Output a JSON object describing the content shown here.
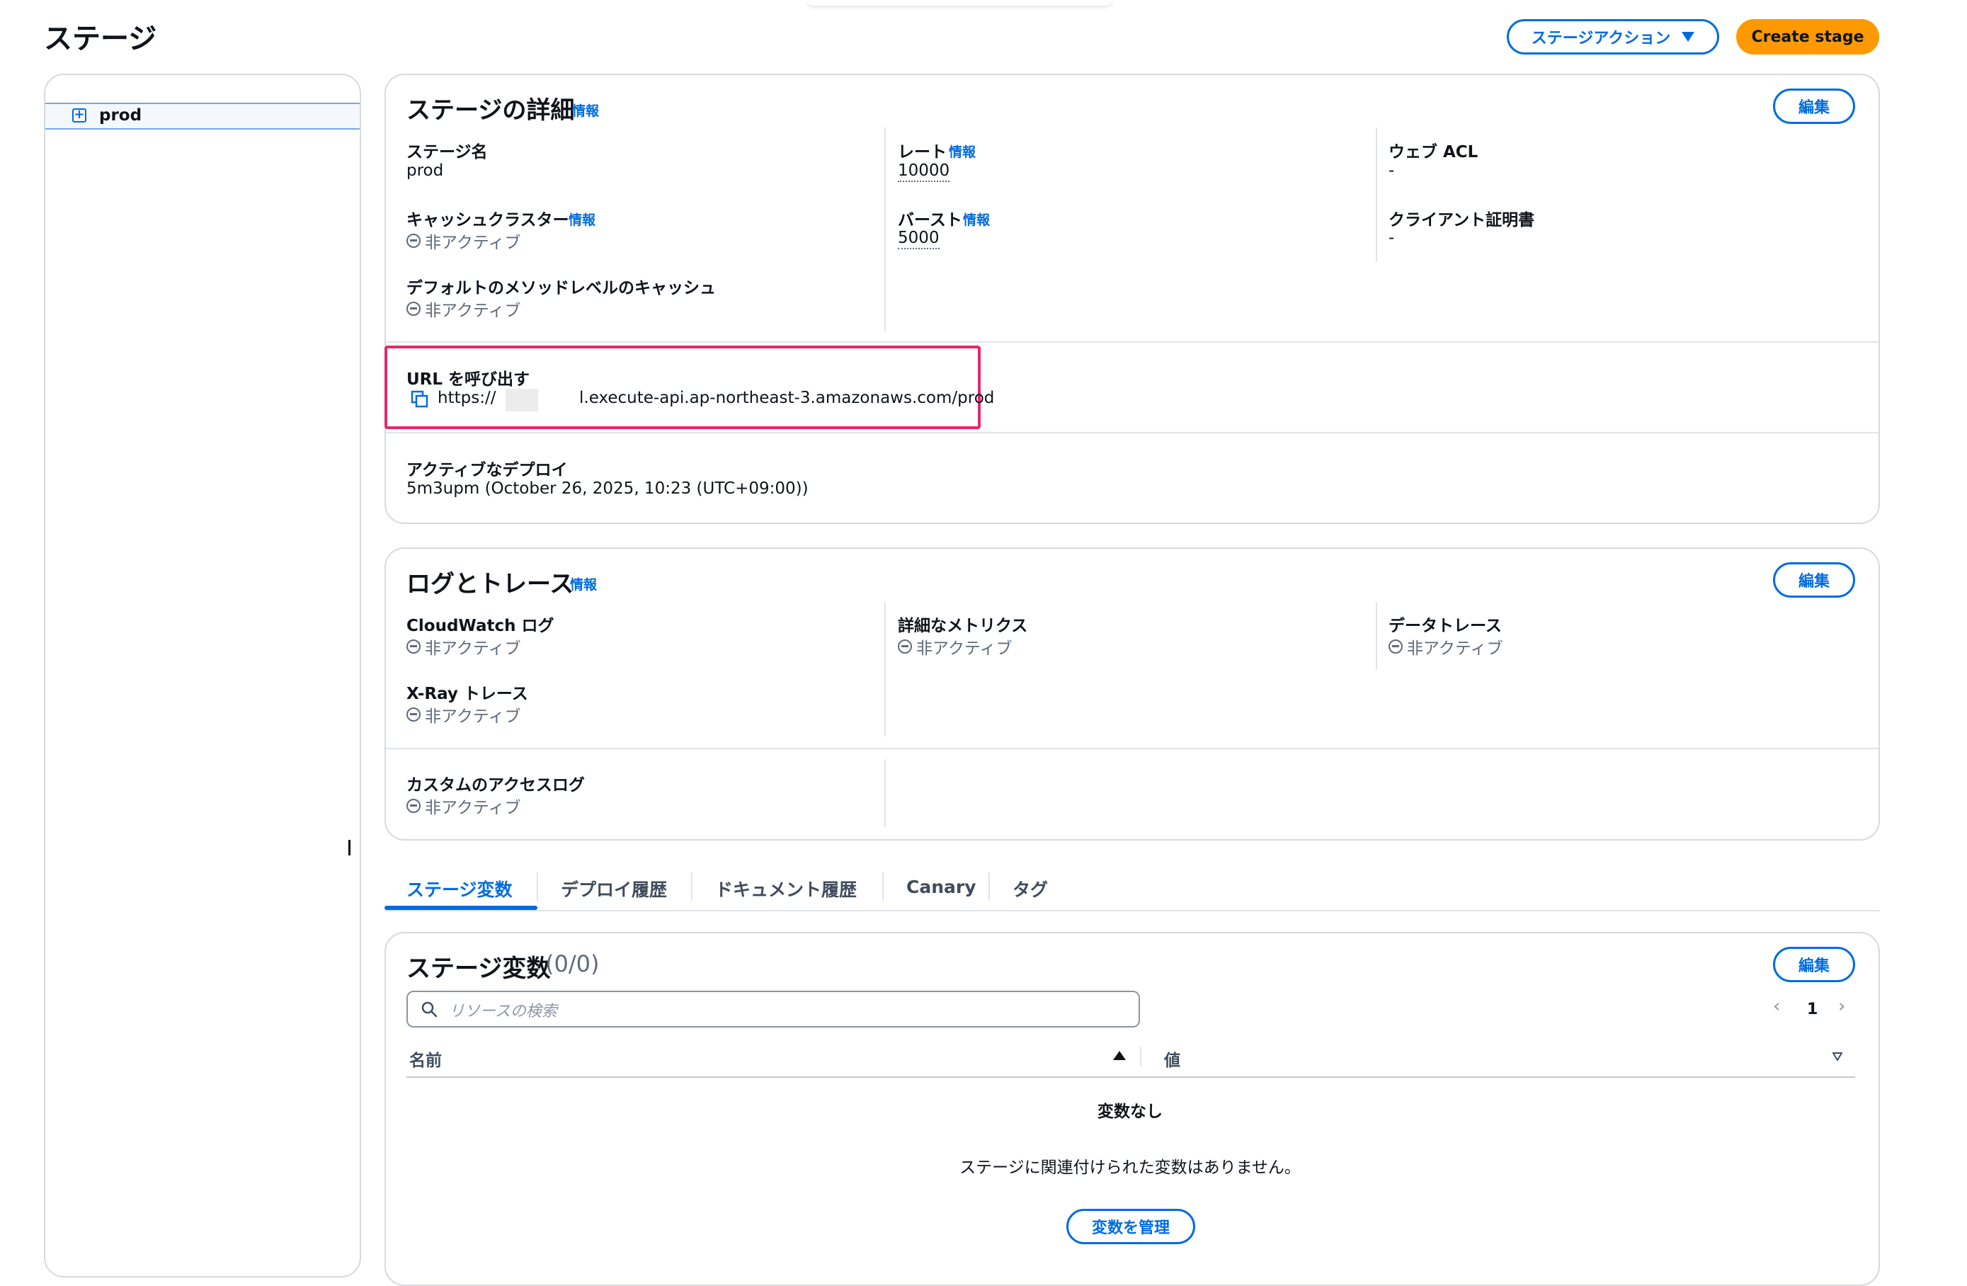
{
  "page": {
    "title": "ステージ",
    "stage_actions_label": "ステージアクション",
    "create_stage_label": "Create stage"
  },
  "sidebar": {
    "items": [
      {
        "label": "prod"
      }
    ]
  },
  "stage_details": {
    "title": "ステージの詳細",
    "info": "情報",
    "edit_label": "編集",
    "stage_name_label": "ステージ名",
    "stage_name_value": "prod",
    "cache_cluster_label": "キャッシュクラスター",
    "cache_cluster_info": "情報",
    "cache_cluster_status": "非アクティブ",
    "default_cache_label": "デフォルトのメソッドレベルのキャッシュ",
    "default_cache_status": "非アクティブ",
    "rate_label": "レート",
    "rate_info": "情報",
    "rate_value": "10000",
    "burst_label": "バースト",
    "burst_info": "情報",
    "burst_value": "5000",
    "web_acl_label": "ウェブ ACL",
    "web_acl_value": "-",
    "client_cert_label": "クライアント証明書",
    "client_cert_value": "-",
    "invoke_url_label": "URL を呼び出す",
    "invoke_url_prefix": "https://",
    "invoke_url_suffix": "l.execute-api.ap-northeast-3.amazonaws.com/prod",
    "active_deploy_label": "アクティブなデプロイ",
    "active_deploy_value": "5m3upm (October 26, 2025, 10:23 (UTC+09:00))"
  },
  "logs": {
    "title": "ログとトレース",
    "info": "情報",
    "edit_label": "編集",
    "cloudwatch_label": "CloudWatch ログ",
    "cloudwatch_status": "非アクティブ",
    "xray_label": "X-Ray トレース",
    "xray_status": "非アクティブ",
    "metrics_label": "詳細なメトリクス",
    "metrics_status": "非アクティブ",
    "data_trace_label": "データトレース",
    "data_trace_status": "非アクティブ",
    "custom_access_label": "カスタムのアクセスログ",
    "custom_access_status": "非アクティブ"
  },
  "tabs": [
    {
      "label": "ステージ変数",
      "active": true
    },
    {
      "label": "デプロイ履歴"
    },
    {
      "label": "ドキュメント履歴"
    },
    {
      "label": "Canary"
    },
    {
      "label": "タグ"
    }
  ],
  "stage_vars": {
    "title": "ステージ変数",
    "count": "(0/0)",
    "edit_label": "編集",
    "search_placeholder": "リソースの検索",
    "page_number": "1",
    "col_name": "名前",
    "col_value": "値",
    "empty_title": "変数なし",
    "empty_text": "ステージに関連付けられた変数はありません。",
    "manage_label": "変数を管理"
  },
  "colors": {
    "accent": "#006ce0",
    "primary_button": "#ff9900",
    "highlight": "#e5286c",
    "muted_text": "#5f6b7a",
    "border": "#d6dade"
  },
  "icons": [
    "expand-icon",
    "chevron-down-icon",
    "copy-icon",
    "inactive-status-icon",
    "search-icon",
    "chevron-left-icon",
    "chevron-right-icon",
    "sort-ascending-icon",
    "sort-descending-icon"
  ]
}
